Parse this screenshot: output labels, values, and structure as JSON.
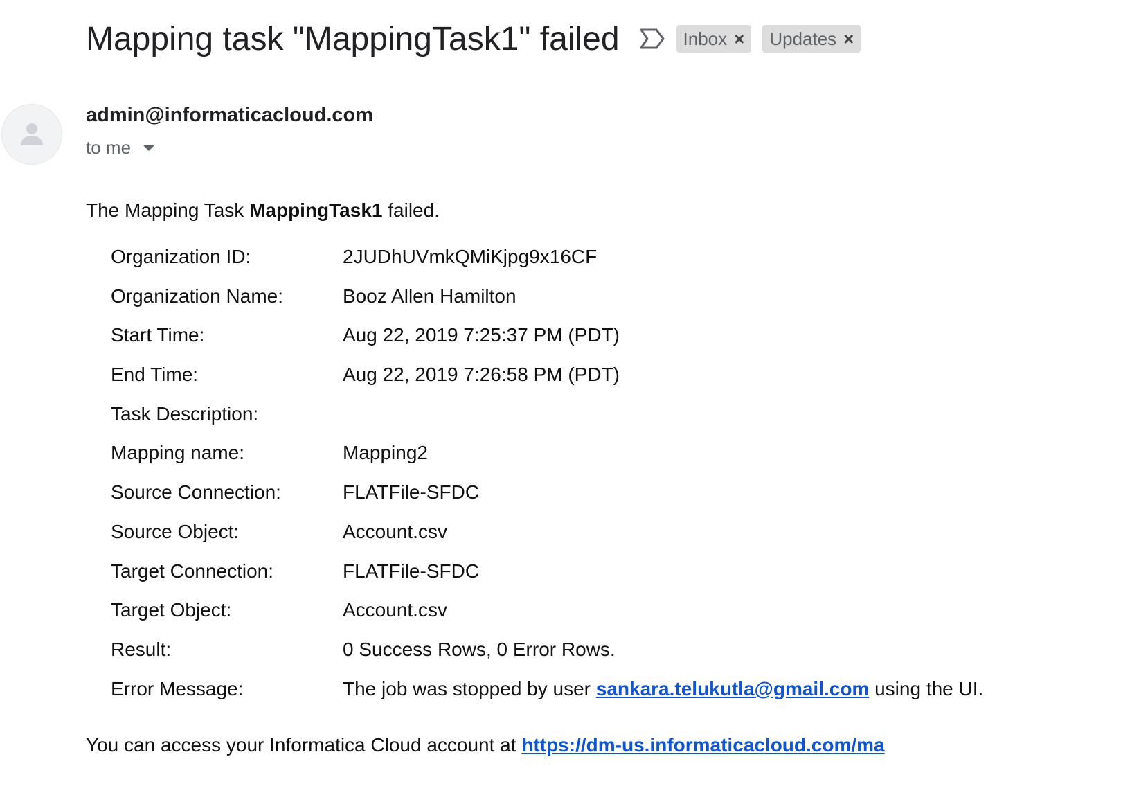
{
  "email": {
    "subject": "Mapping task \"MappingTask1\" failed",
    "labels": [
      {
        "name": "Inbox",
        "remove": "×"
      },
      {
        "name": "Updates",
        "remove": "×"
      }
    ],
    "sender": "admin@informaticacloud.com",
    "recipient": "to me"
  },
  "body": {
    "intro_prefix": "The Mapping Task ",
    "intro_task": "MappingTask1",
    "intro_suffix": " failed.",
    "details": [
      {
        "label": "Organization ID:",
        "value": "2JUDhUVmkQMiKjpg9x16CF"
      },
      {
        "label": "Organization Name:",
        "value": "Booz Allen Hamilton"
      },
      {
        "label": "Start Time:",
        "value": "Aug 22, 2019 7:25:37 PM (PDT)"
      },
      {
        "label": "End Time:",
        "value": "Aug 22, 2019 7:26:58 PM (PDT)"
      },
      {
        "label": "Task Description:",
        "value": ""
      },
      {
        "label": "Mapping name:",
        "value": "Mapping2"
      },
      {
        "label": "Source Connection:",
        "value": "FLATFile-SFDC"
      },
      {
        "label": "Source Object:",
        "value": "Account.csv"
      },
      {
        "label": "Target Connection:",
        "value": "FLATFile-SFDC"
      },
      {
        "label": "Target Object:",
        "value": "Account.csv"
      },
      {
        "label": "Result:",
        "value": "0 Success Rows, 0 Error Rows."
      }
    ],
    "error": {
      "label": "Error Message:",
      "prefix": "The job was stopped by user ",
      "user_link": "sankara.telukutla@gmail.com",
      "suffix": " using the UI."
    },
    "footer_prefix": "You can access your Informatica Cloud account at ",
    "footer_link": "https://dm-us.informaticacloud.com/ma"
  },
  "icons": {
    "important": "important-marker-icon",
    "avatar": "default-avatar-icon",
    "dropdown": "chevron-down-icon",
    "label_remove": "close-icon"
  },
  "colors": {
    "link": "#1155cc",
    "chip_bg": "#dddddd",
    "avatar_bg": "#f1f3f4"
  }
}
